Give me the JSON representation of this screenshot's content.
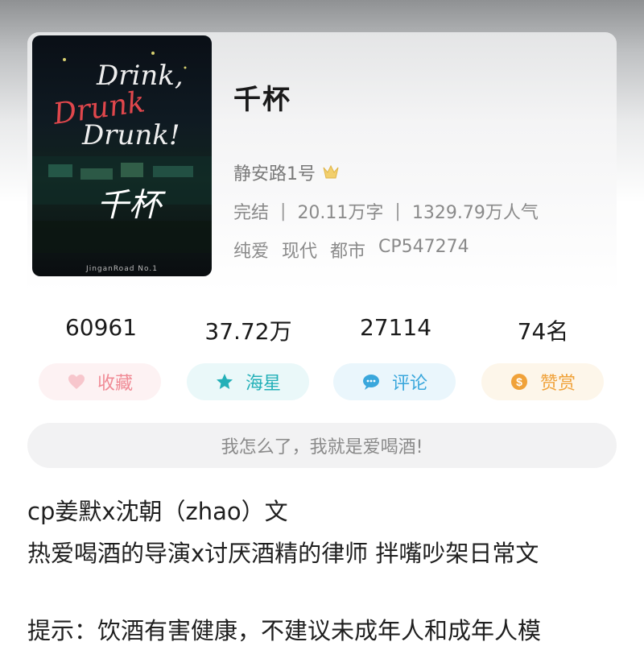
{
  "book": {
    "title": "千杯",
    "author": "静安路1号",
    "author_badge_icon": "vip-crown-icon",
    "status": "完结",
    "word_count": "20.11万字",
    "popularity": "1329.79万人气",
    "tags": [
      "纯爱",
      "现代",
      "都市",
      "CP547274"
    ],
    "cover": {
      "script_lines": [
        "Drink,",
        "Drunk!"
      ],
      "red_word": "Drunk",
      "title_glyph": "千杯",
      "footer": "JinganRoad No.1"
    }
  },
  "stats": [
    {
      "value": "60961"
    },
    {
      "value": "37.72万"
    },
    {
      "value": "27114"
    },
    {
      "value": "74名"
    }
  ],
  "actions": [
    {
      "label": "收藏",
      "icon": "heart-icon",
      "color": "#f08a95"
    },
    {
      "label": "海星",
      "icon": "star-icon",
      "color": "#23b0b8"
    },
    {
      "label": "评论",
      "icon": "chat-bubble-icon",
      "color": "#3aa7dc"
    },
    {
      "label": "赞赏",
      "icon": "coin-icon",
      "color": "#f0a23a"
    }
  ],
  "quote": "我怎么了，我就是爱喝酒!",
  "description": [
    "cp姜默x沈朝（zhao）文",
    "热爱喝酒的导演x讨厌酒精的律师 拌嘴吵架日常文",
    "提示：饮酒有害健康，不建议未成年人和成年人模"
  ]
}
